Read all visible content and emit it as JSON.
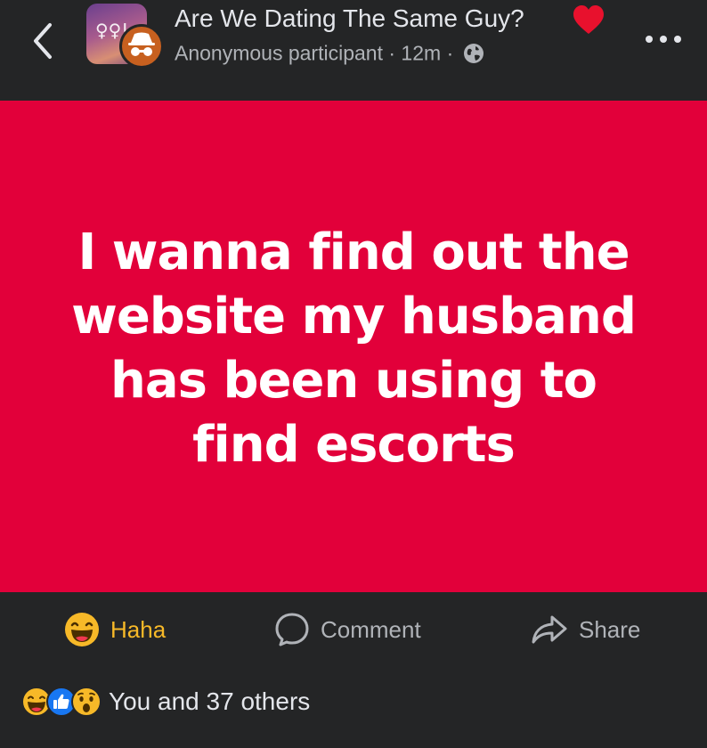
{
  "header": {
    "group_name": "Are We Dating The Same Guy?",
    "author": "Anonymous participant",
    "separator": "·",
    "time": "12m",
    "group_avatar_symbols": "♀♀!",
    "icons": {
      "back": "chevron-left-icon",
      "heart": "red-heart-icon",
      "anon": "incognito-icon",
      "privacy": "globe-icon",
      "more": "more-horizontal-icon"
    }
  },
  "post": {
    "text": "I wanna find out the website my husband has been using to find escorts",
    "background_color": "#e2003a"
  },
  "actions": {
    "haha_label": "Haha",
    "comment_label": "Comment",
    "share_label": "Share",
    "haha_color": "#f7b928"
  },
  "reactions": {
    "icons": [
      "haha-icon",
      "like-icon",
      "wow-icon"
    ],
    "summary": "You and 37 others"
  }
}
